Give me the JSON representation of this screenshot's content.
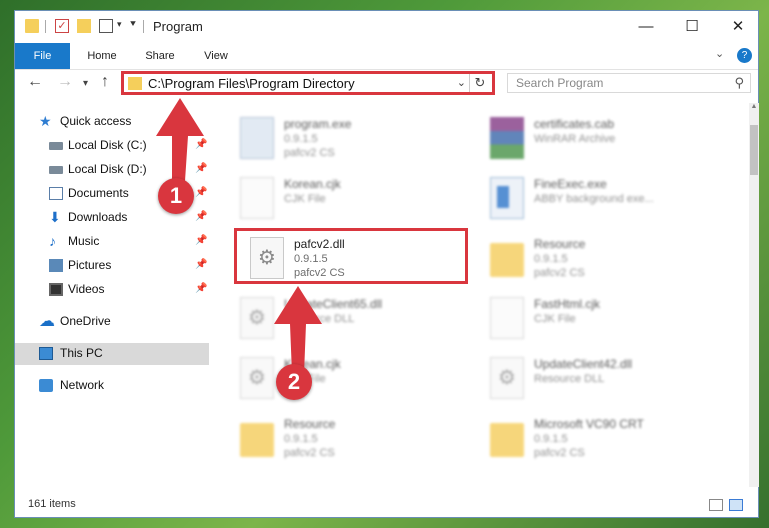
{
  "window": {
    "title": "Program",
    "buttons": {
      "minimize": "—",
      "maximize": "☐",
      "close": "✕"
    }
  },
  "ribbon": {
    "tabs": [
      {
        "label": "File"
      },
      {
        "label": "Home"
      },
      {
        "label": "Share"
      },
      {
        "label": "View"
      }
    ],
    "help": "?"
  },
  "navigation": {
    "address": "C:\\Program Files\\Program Directory",
    "search_placeholder": "Search Program"
  },
  "sidebar": {
    "items": [
      {
        "label": "Quick access",
        "icon": "star-icon"
      },
      {
        "label": "Local Disk (C:)",
        "icon": "disk-icon",
        "pinned": true
      },
      {
        "label": "Local Disk (D:)",
        "icon": "disk-icon",
        "pinned": true
      },
      {
        "label": "Documents",
        "icon": "documents-icon",
        "pinned": true
      },
      {
        "label": "Downloads",
        "icon": "download-icon",
        "pinned": true
      },
      {
        "label": "Music",
        "icon": "music-icon",
        "pinned": true
      },
      {
        "label": "Pictures",
        "icon": "pictures-icon",
        "pinned": true
      },
      {
        "label": "Videos",
        "icon": "videos-icon",
        "pinned": true
      },
      {
        "label": "OneDrive",
        "icon": "cloud-icon"
      },
      {
        "label": "This PC",
        "icon": "computer-icon",
        "selected": true
      },
      {
        "label": "Network",
        "icon": "network-icon"
      }
    ]
  },
  "files": [
    {
      "name": "program.exe",
      "line2": "0.9.1.5",
      "line3": "pafcv2 CS",
      "icon": "exe-icon"
    },
    {
      "name": "certificates.cab",
      "line2": "WinRAR Archive",
      "line3": "",
      "icon": "archive-icon"
    },
    {
      "name": "Korean.cjk",
      "line2": "CJK File",
      "line3": "",
      "icon": "document-icon"
    },
    {
      "name": "FineExec.exe",
      "line2": "ABBY background exe...",
      "line3": "",
      "icon": "exe-icon"
    },
    {
      "name": "pafcv2.dll",
      "line2": "0.9.1.5",
      "line3": "pafcv2 CS",
      "icon": "dll-gear-icon"
    },
    {
      "name": "Resource",
      "line2": "0.9.1.5",
      "line3": "pafcv2 CS",
      "icon": "folder-icon"
    },
    {
      "name": "UpdateClient65.dll",
      "line2": "Resource DLL",
      "line3": "",
      "icon": "dll-gear-icon"
    },
    {
      "name": "FastHtml.cjk",
      "line2": "CJK File",
      "line3": "",
      "icon": "document-icon"
    },
    {
      "name": "Korean.cjk",
      "line2": "CJK File",
      "line3": "",
      "icon": "dll-gear-icon"
    },
    {
      "name": "UpdateClient42.dll",
      "line2": "Resource DLL",
      "line3": "",
      "icon": "dll-gear-icon"
    },
    {
      "name": "Resource",
      "line2": "0.9.1.5",
      "line3": "pafcv2 CS",
      "icon": "folder-icon"
    },
    {
      "name": "Microsoft VC90 CRT",
      "line2": "0.9.1.5",
      "line3": "pafcv2 CS",
      "icon": "folder-icon"
    }
  ],
  "status": {
    "items_count": "161 items"
  },
  "annotations": {
    "step1": "1",
    "step2": "2"
  },
  "colors": {
    "accent": "#1979ca",
    "highlight": "#d9363e"
  }
}
